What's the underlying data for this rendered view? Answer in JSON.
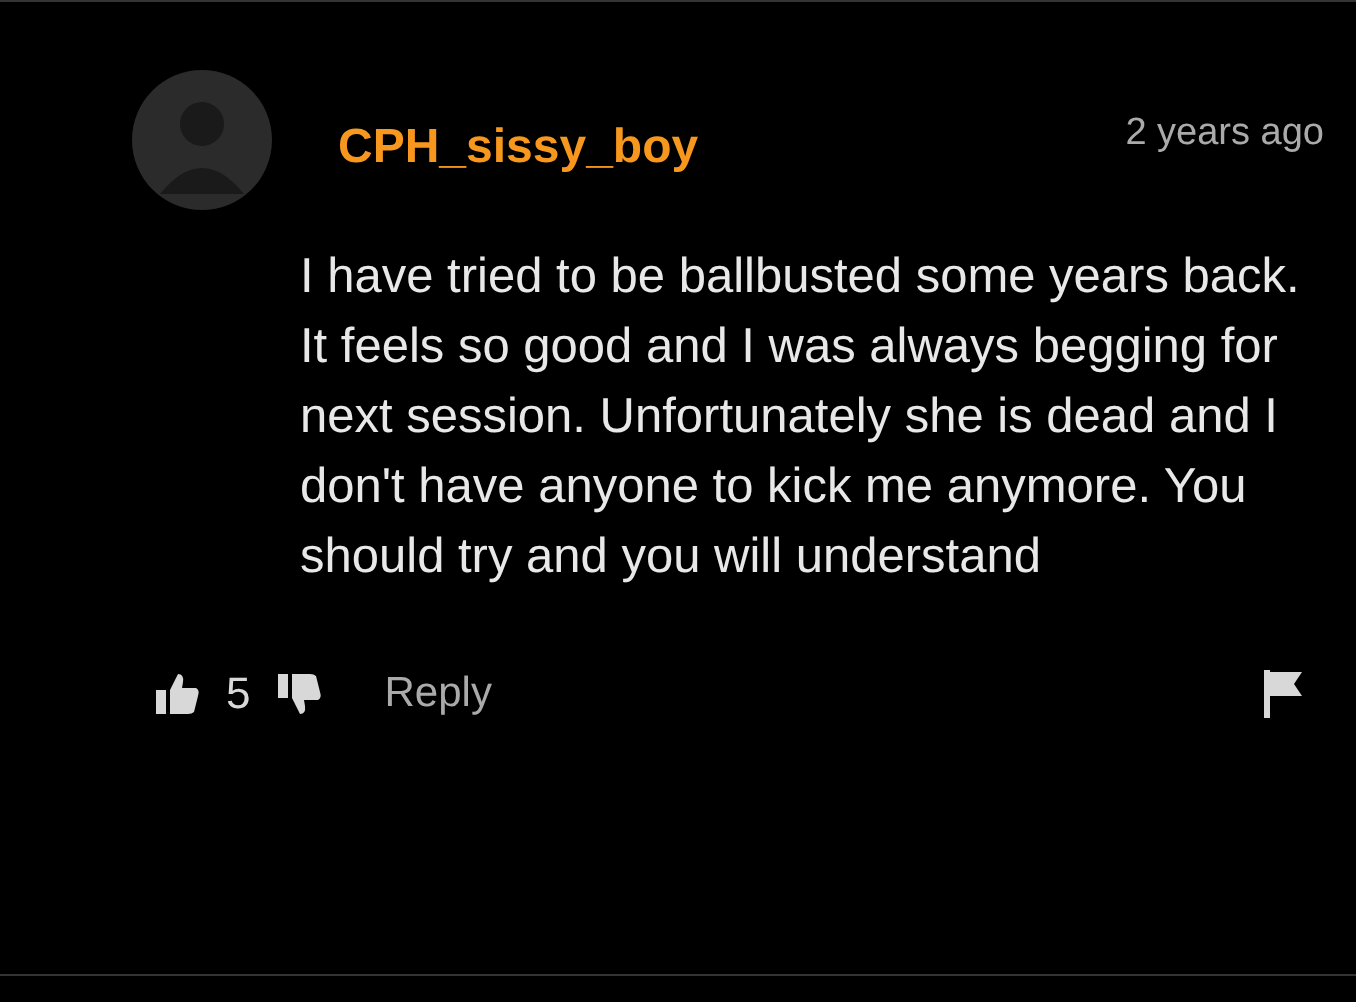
{
  "comment": {
    "author": "CPH_sissy_boy",
    "time": "2 years ago",
    "text": "I have tried to be ballbusted some years back. It feels so good and I was always begging for next session. Unfortunately she is dead and I don't have anyone to kick me anymore. You should try and you will understand",
    "likes": "5",
    "reply": "Reply"
  }
}
